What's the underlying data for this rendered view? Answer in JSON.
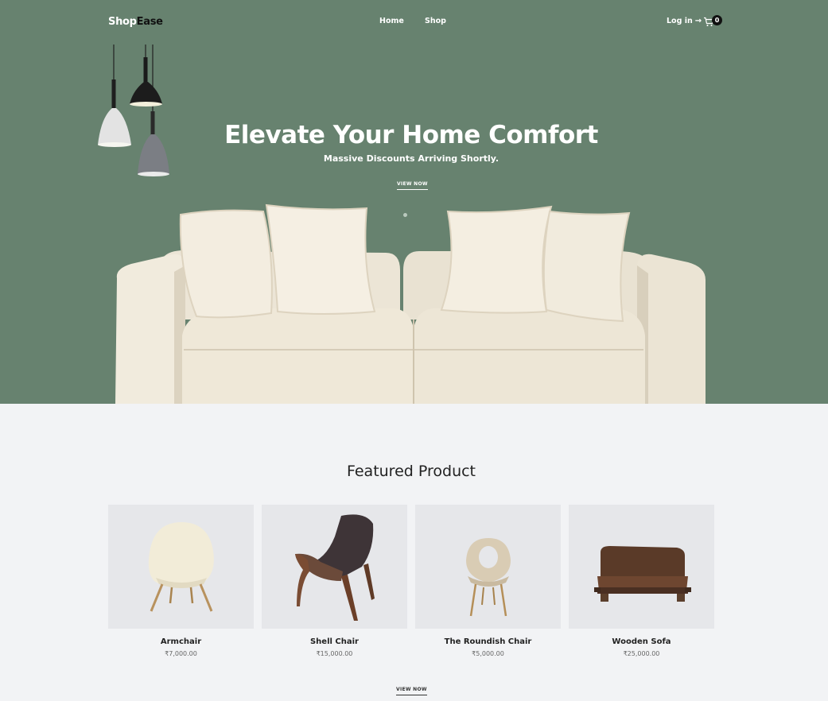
{
  "header": {
    "logo_part1": "Shop",
    "logo_part2": "Ease",
    "nav": [
      "Home",
      "Shop"
    ],
    "login_label": "Log in",
    "login_arrow": "→",
    "cart_count": "0"
  },
  "hero": {
    "title": "Elevate Your Home Comfort",
    "subtitle": "Massive Discounts Arriving Shortly.",
    "cta_label": "VIEW NOW",
    "background_color": "#67826f"
  },
  "featured": {
    "title": "Featured Product",
    "products": [
      {
        "name": "Armchair",
        "price": "₹7,000.00",
        "icon": "armchair-image"
      },
      {
        "name": "Shell Chair",
        "price": "₹15,000.00",
        "icon": "shell-chair-image"
      },
      {
        "name": "The Roundish Chair",
        "price": "₹5,000.00",
        "icon": "roundish-chair-image"
      },
      {
        "name": "Wooden Sofa",
        "price": "₹25,000.00",
        "icon": "wooden-sofa-image"
      }
    ],
    "cta_label": "VIEW NOW"
  }
}
